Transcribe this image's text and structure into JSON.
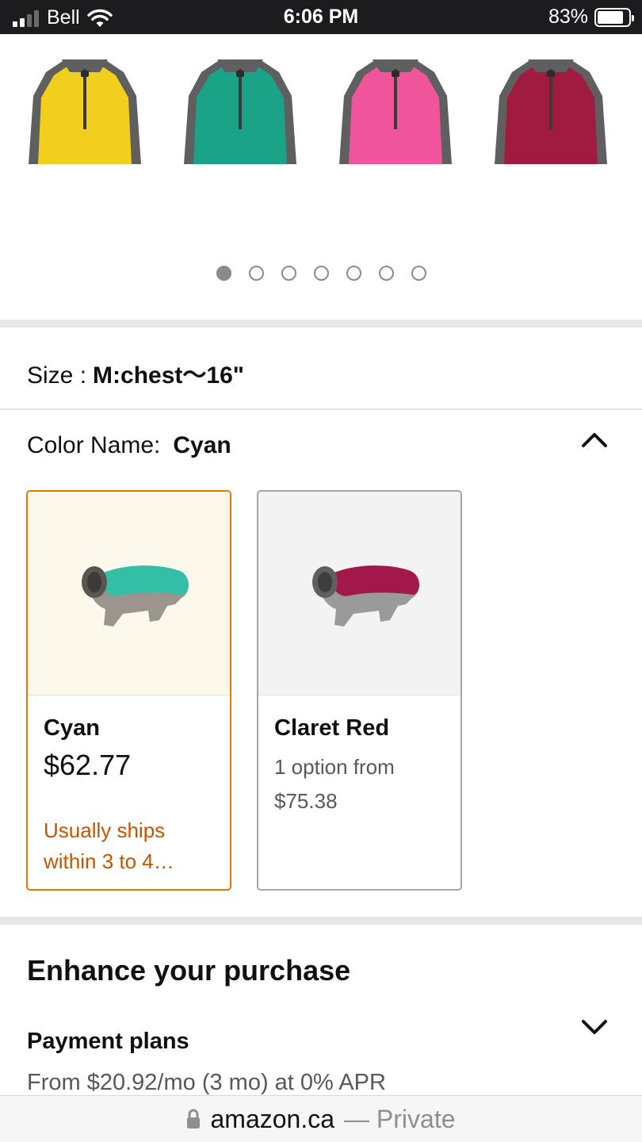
{
  "status_bar": {
    "carrier": "Bell",
    "time": "6:06 PM",
    "battery": "83%",
    "battery_level": 0.83,
    "icons": [
      "signal-icon",
      "wifi-icon",
      "battery-icon"
    ]
  },
  "carousel": {
    "thumbnails": [
      {
        "color": "#f2cf1d",
        "alt": "yellow"
      },
      {
        "color": "#1aa387",
        "alt": "green"
      },
      {
        "color": "#f0559b",
        "alt": "pink"
      },
      {
        "color": "#a11a40",
        "alt": "maroon"
      }
    ],
    "trim_color": "#5f5f5f",
    "page_count": 7,
    "active_page": 1
  },
  "size": {
    "label": "Size :",
    "value": "M:chest～16\""
  },
  "color": {
    "label": "Color Name:",
    "value": "Cyan",
    "toggle_icon": "chevron-up-icon"
  },
  "swatches": [
    {
      "name": "Cyan",
      "price": "$62.77",
      "shipping": "Usually ships within 3 to 4…",
      "selected": true,
      "color": "#33bfa6"
    },
    {
      "name": "Claret Red",
      "option_text": "1 option from $75.38",
      "selected": false,
      "color": "#a3184a"
    }
  ],
  "enhance": {
    "title": "Enhance your purchase",
    "payment_title": "Payment plans",
    "payment_sub": "From $20.92/mo (3 mo) at 0% APR",
    "toggle_icon": "chevron-down-icon"
  },
  "url_bar": {
    "domain": "amazon.ca",
    "suffix": "— Private",
    "icon": "lock-icon"
  },
  "colors": {
    "accent_border": "#e77600",
    "shipping_text": "#c45500"
  }
}
